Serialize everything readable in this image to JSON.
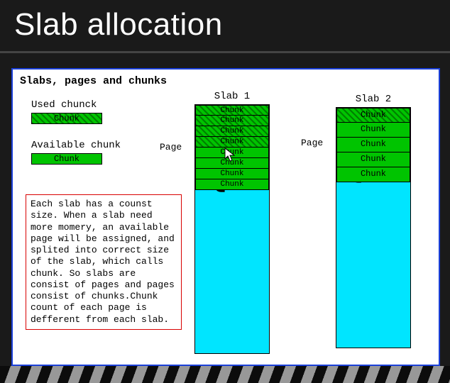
{
  "title": "Slab allocation",
  "diagram": {
    "heading": "Slabs, pages and chunks",
    "legend": {
      "used_label": "Used chunck",
      "used_text": "Chunk",
      "avail_label": "Available chunk",
      "avail_text": "Chunk"
    },
    "page_label": "Page",
    "slab1": {
      "label": "Slab 1",
      "chunks": [
        {
          "text": "Chunk",
          "used": true
        },
        {
          "text": "Chunk",
          "used": true
        },
        {
          "text": "Chunk",
          "used": true
        },
        {
          "text": "Chunk",
          "used": true
        },
        {
          "text": "Chunk",
          "used": false
        },
        {
          "text": "Chunk",
          "used": false
        },
        {
          "text": "Chunk",
          "used": false
        },
        {
          "text": "Chunk",
          "used": false
        }
      ]
    },
    "slab2": {
      "label": "Slab 2",
      "chunks": [
        {
          "text": "Chunk",
          "used": true
        },
        {
          "text": "Chunk",
          "used": false
        },
        {
          "text": "Chunk",
          "used": false
        },
        {
          "text": "Chunk",
          "used": false
        },
        {
          "text": "Chunk",
          "used": false
        }
      ]
    },
    "description": "Each slab has a counst size. When a slab need more momery, an available page will be assigned, and splited into correct size of the slab, which calls chunk. So slabs are consist of pages and pages consist of chunks.Chunk count of each page is defferent from each slab."
  },
  "colors": {
    "chunk_green": "#00c400",
    "slab_cyan": "#00e5ff",
    "border_blue": "#1a3fd8",
    "desc_red": "#d80000"
  }
}
